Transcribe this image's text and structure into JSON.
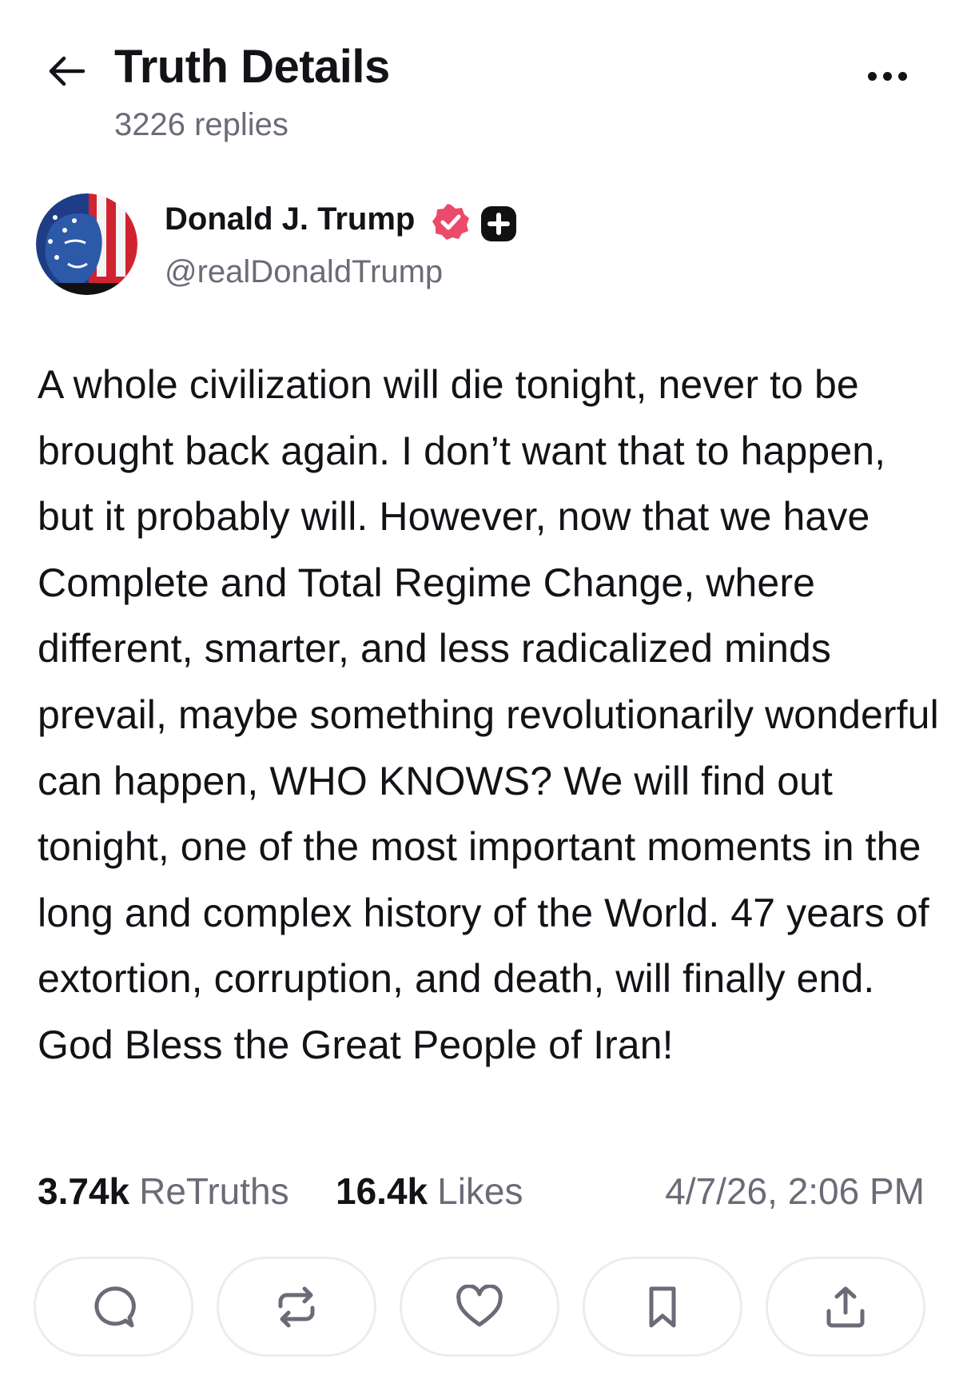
{
  "header": {
    "back_icon": "arrow-left-icon",
    "title": "Truth Details",
    "subtitle": "3226 replies",
    "more_icon": "more-horizontal-icon"
  },
  "post": {
    "author": {
      "name": "Donald J. Trump",
      "handle": "@realDonaldTrump",
      "avatar_icon": "avatar-image",
      "verified_icon": "verified-badge-icon",
      "plus_icon": "plus-badge-icon"
    },
    "text": "A whole civilization will die tonight, never to be brought back again. I don’t want that to happen, but it probably will. However, now that we have Complete and Total Regime Change, where different, smarter, and less radicalized minds prevail, maybe something revolutionarily wonderful can happen, WHO KNOWS? We will find out tonight, one of the most important moments in the long and complex history of the World. 47 years of extortion, corruption, and death, will finally end. God Bless the Great People of Iran!",
    "stats": {
      "retruths_count": "3.74k",
      "retruths_label": "ReTruths",
      "likes_count": "16.4k",
      "likes_label": "Likes"
    },
    "timestamp": "4/7/26, 2:06 PM"
  },
  "actions": [
    {
      "icon": "reply-icon"
    },
    {
      "icon": "retruth-icon"
    },
    {
      "icon": "heart-icon"
    },
    {
      "icon": "bookmark-icon"
    },
    {
      "icon": "share-icon"
    }
  ],
  "colors": {
    "text_primary": "#121217",
    "text_secondary": "#6b6b78",
    "verified_badge": "#ec4a6b",
    "button_border": "#ececf0",
    "icon_gray": "#6b6b78"
  }
}
